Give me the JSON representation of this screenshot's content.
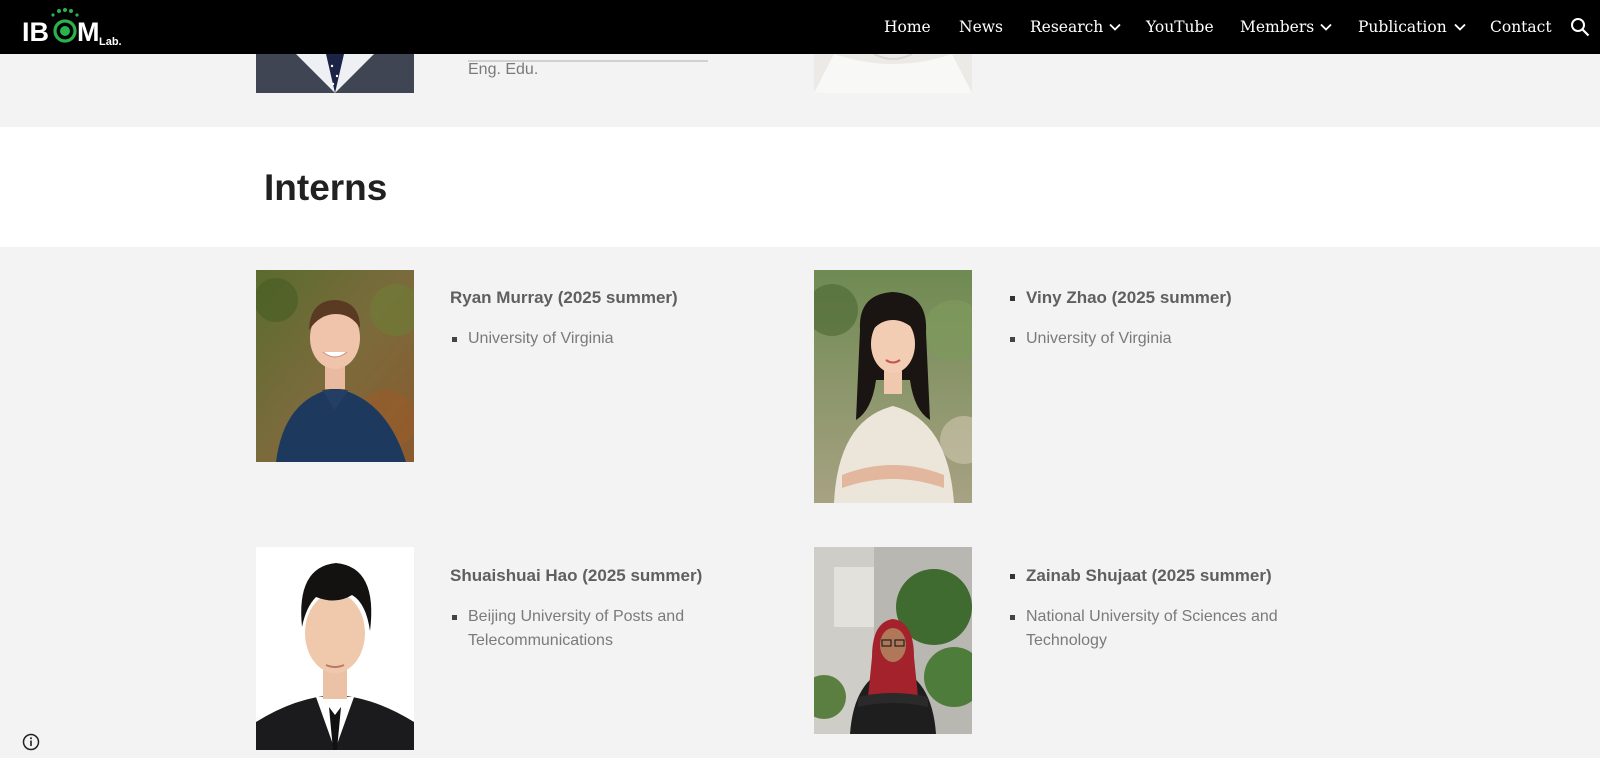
{
  "header": {
    "logo_text": "IBOM",
    "logo_suffix": "Lab.",
    "nav": {
      "home": "Home",
      "news": "News",
      "research": "Research",
      "youtube": "YouTube",
      "members": "Members",
      "publication": "Publication",
      "contact": "Contact"
    },
    "colors": {
      "bar": "#000000",
      "text": "#ffffff",
      "logo_accent": "#2bb24c"
    }
  },
  "previous_section": {
    "text_tail": "Eng. Edu."
  },
  "interns_section": {
    "title": "Interns",
    "interns": [
      {
        "name": "Ryan Murray (2025 summer)",
        "affiliation": "University of Virginia"
      },
      {
        "name": "Viny Zhao (2025 summer)",
        "affiliation": "University of Virginia"
      },
      {
        "name": "Shuaishuai Hao (2025 summer)",
        "affiliation_line1": "Beijing University of Posts and",
        "affiliation_line2": "Telecommunications"
      },
      {
        "name": "Zainab Shujaat (2025 summer)",
        "affiliation_line1": "National University of Sciences and",
        "affiliation_line2": "Technology"
      }
    ]
  },
  "icons": [
    "search-icon",
    "chevron-down-icon",
    "info-icon"
  ]
}
